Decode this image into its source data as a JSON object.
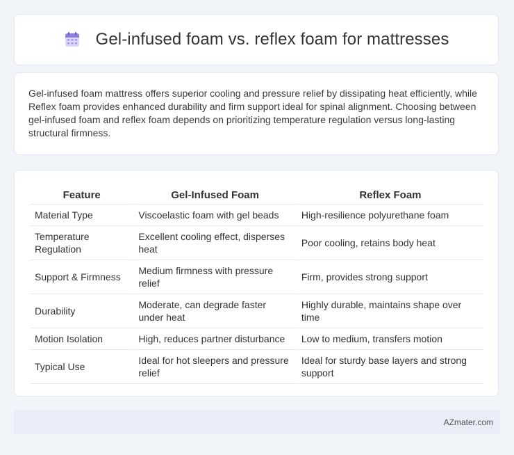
{
  "header": {
    "title": "Gel-infused foam vs. reflex foam for mattresses",
    "icon": "calendar-icon"
  },
  "summary": {
    "text": "Gel-infused foam mattress offers superior cooling and pressure relief by dissipating heat efficiently, while Reflex foam provides enhanced durability and firm support ideal for spinal alignment. Choosing between gel-infused foam and reflex foam depends on prioritizing temperature regulation versus long-lasting structural firmness."
  },
  "table": {
    "headers": [
      "Feature",
      "Gel-Infused Foam",
      "Reflex Foam"
    ],
    "rows": [
      [
        "Material Type",
        "Viscoelastic foam with gel beads",
        "High-resilience polyurethane foam"
      ],
      [
        "Temperature Regulation",
        "Excellent cooling effect, disperses heat",
        "Poor cooling, retains body heat"
      ],
      [
        "Support & Firmness",
        "Medium firmness with pressure relief",
        "Firm, provides strong support"
      ],
      [
        "Durability",
        "Moderate, can degrade faster under heat",
        "Highly durable, maintains shape over time"
      ],
      [
        "Motion Isolation",
        "High, reduces partner disturbance",
        "Low to medium, transfers motion"
      ],
      [
        "Typical Use",
        "Ideal for hot sleepers and pressure relief",
        "Ideal for sturdy base layers and strong support"
      ]
    ]
  },
  "footer": {
    "brand": "AZmater.com"
  },
  "colors": {
    "page_background": "#f1f4f8",
    "card_background": "#ffffff",
    "footer_background": "#e8edf7",
    "icon_accent": "#8f7fe0"
  }
}
